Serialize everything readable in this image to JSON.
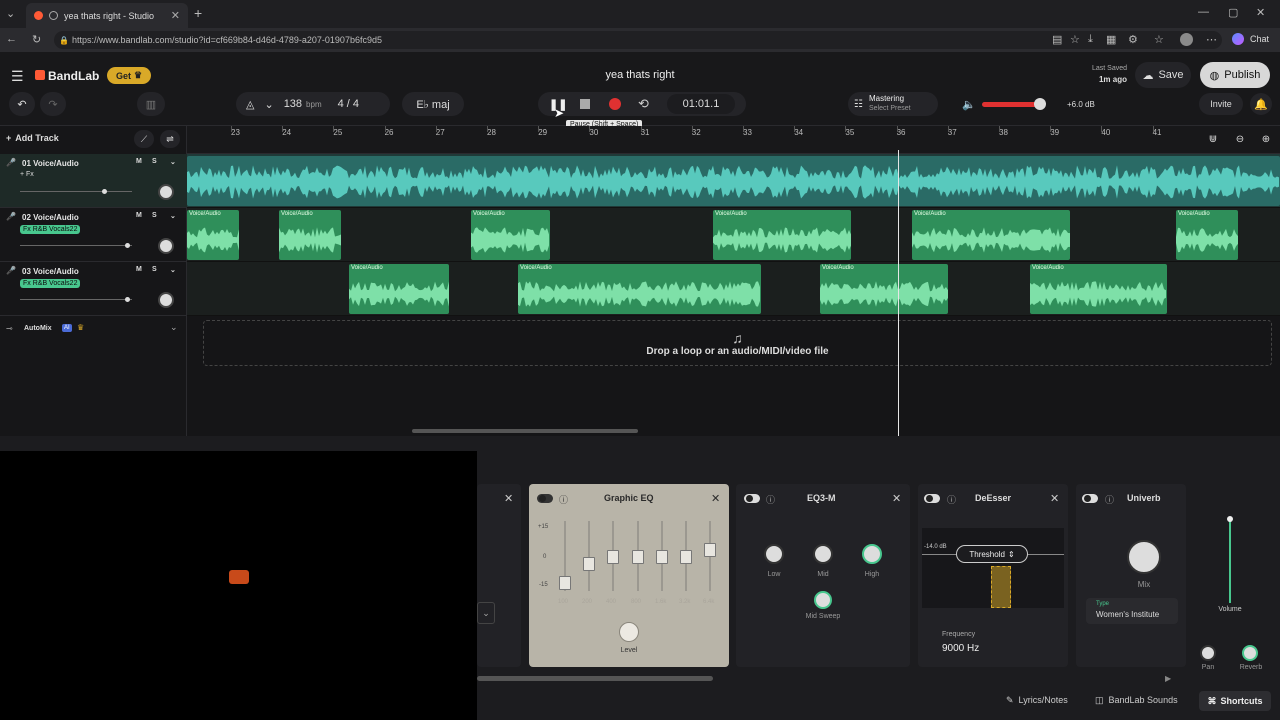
{
  "browser": {
    "tab_title": "yea thats right - Studio",
    "url": "https://www.bandlab.com/studio?id=cf669b84-d46d-4789-a207-01907b6fc9d5",
    "chat_label": "Chat"
  },
  "header": {
    "logo": "BandLab",
    "get_label": "Get",
    "project_title": "yea thats right",
    "last_saved_label": "Last Saved",
    "last_saved_time": "1m ago",
    "save_label": "Save",
    "publish_label": "Publish",
    "invite_label": "Invite"
  },
  "toolbar": {
    "bpm_value": "138",
    "bpm_unit": "bpm",
    "time_sig": "4 / 4",
    "key": "E♭ maj",
    "time": "01:01.1",
    "tooltip": "Pause (Shift + Space)",
    "mastering_label": "Mastering",
    "mastering_sub": "Select Preset",
    "volume_db": "+6.0 dB",
    "add_track_label": "Add Track"
  },
  "ruler": {
    "bars": [
      "23",
      "24",
      "25",
      "26",
      "27",
      "28",
      "29",
      "30",
      "31",
      "32",
      "33",
      "34",
      "35",
      "36",
      "37",
      "38",
      "39",
      "40",
      "41"
    ]
  },
  "tracks": [
    {
      "name": "01  Voice/Audio",
      "fx": "+ Fx"
    },
    {
      "name": "02  Voice/Audio",
      "fx": "Fx R&B Vocals22"
    },
    {
      "name": "03  Voice/Audio",
      "fx": "Fx R&B Vocals22"
    }
  ],
  "track_buttons": {
    "mute": "M",
    "solo": "S"
  },
  "automix": {
    "label": "AutoMix",
    "badge": "AI"
  },
  "clip_label": "Voice/Audio",
  "dropzone": {
    "text": "Drop a loop or an audio/MIDI/video file"
  },
  "effects": {
    "graphic_eq": {
      "title": "Graphic EQ",
      "scale": [
        "+15",
        "0",
        "-15"
      ],
      "freqs": [
        "100",
        "200",
        "400",
        "800",
        "1.6k",
        "3.2k",
        "6.4k"
      ],
      "level_label": "Level"
    },
    "eq3m": {
      "title": "EQ3-M",
      "knobs": [
        "Low",
        "Mid",
        "High"
      ],
      "sweep_label": "Mid Sweep"
    },
    "deesser": {
      "title": "DeEsser",
      "threshold_label": "Threshold",
      "db_label": "-14.0 dB",
      "freq_label": "Frequency",
      "freq_value": "9000 Hz"
    },
    "univerb": {
      "title": "Univerb",
      "mix_label": "Mix",
      "type_label": "Type",
      "type_value": "Women's Institute"
    },
    "volume_label": "Volume",
    "pan_label": "Pan",
    "reverb_label": "Reverb"
  },
  "footer": {
    "lyrics_label": "Lyrics/Notes",
    "sounds_label": "BandLab Sounds",
    "shortcuts_label": "Shortcuts"
  },
  "colors": {
    "track1": "#3aa39a",
    "track_green": "#48c78e",
    "record": "#e03131",
    "accent_orange": "#ff6a3d"
  }
}
